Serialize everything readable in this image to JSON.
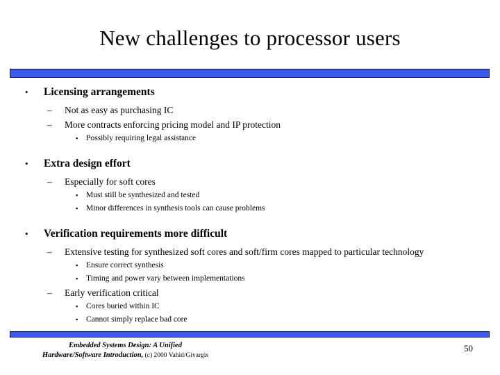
{
  "slide": {
    "title": "New challenges to processor users",
    "accent_color": "#3a5bf0",
    "accent_border_color": "#111133",
    "background_color": "#ffffff",
    "text_color": "#000000"
  },
  "bullets": {
    "level1_marker": "•",
    "level2_marker": "–",
    "level3_marker": "▪"
  },
  "sections": [
    {
      "heading": "Licensing arrangements",
      "sub": [
        {
          "text": "Not as easy as purchasing IC",
          "children": []
        },
        {
          "text": "More contracts enforcing pricing model and IP protection",
          "children": [
            "Possibly requiring legal assistance"
          ]
        }
      ]
    },
    {
      "heading": "Extra design effort",
      "sub": [
        {
          "text": "Especially for soft cores",
          "children": [
            "Must still be synthesized and tested",
            "Minor differences in synthesis tools can cause problems"
          ]
        }
      ]
    },
    {
      "heading": "Verification requirements more difficult",
      "sub": [
        {
          "text": "Extensive testing for synthesized soft cores and soft/firm cores mapped to particular technology",
          "children": [
            "Ensure correct synthesis",
            "Timing and power vary between implementations"
          ]
        },
        {
          "text": "Early verification critical",
          "children": [
            "Cores buried within IC",
            "Cannot simply replace bad core"
          ]
        }
      ]
    }
  ],
  "footer": {
    "credit_line1": "Embedded Systems Design: A Unified",
    "credit_line2": "Hardware/Software Introduction,",
    "credit_copyright": " (c) 2000 Vahid/Givargis",
    "page_number": "50"
  }
}
